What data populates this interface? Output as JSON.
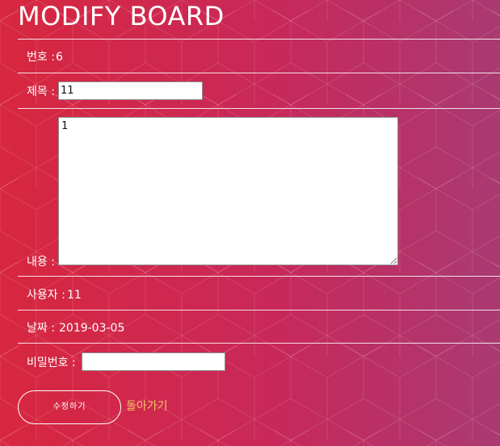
{
  "page": {
    "title": "MODIFY BOARD"
  },
  "form": {
    "number_label": "번호 :",
    "number_value": "6",
    "subject_label": "제목 :",
    "subject_value": "11",
    "content_label": "내용 :",
    "content_value": "1",
    "user_label": "사용자 :",
    "user_value": "11",
    "date_label": "날짜 :",
    "date_value": "2019-03-05",
    "password_label": "비밀번호 :",
    "password_value": ""
  },
  "actions": {
    "submit_label": "수정하기",
    "back_label": "돌아가기"
  },
  "colors": {
    "gradient_left": "#d8273f",
    "gradient_right": "#a93a72",
    "link_color": "#f5c46a"
  }
}
